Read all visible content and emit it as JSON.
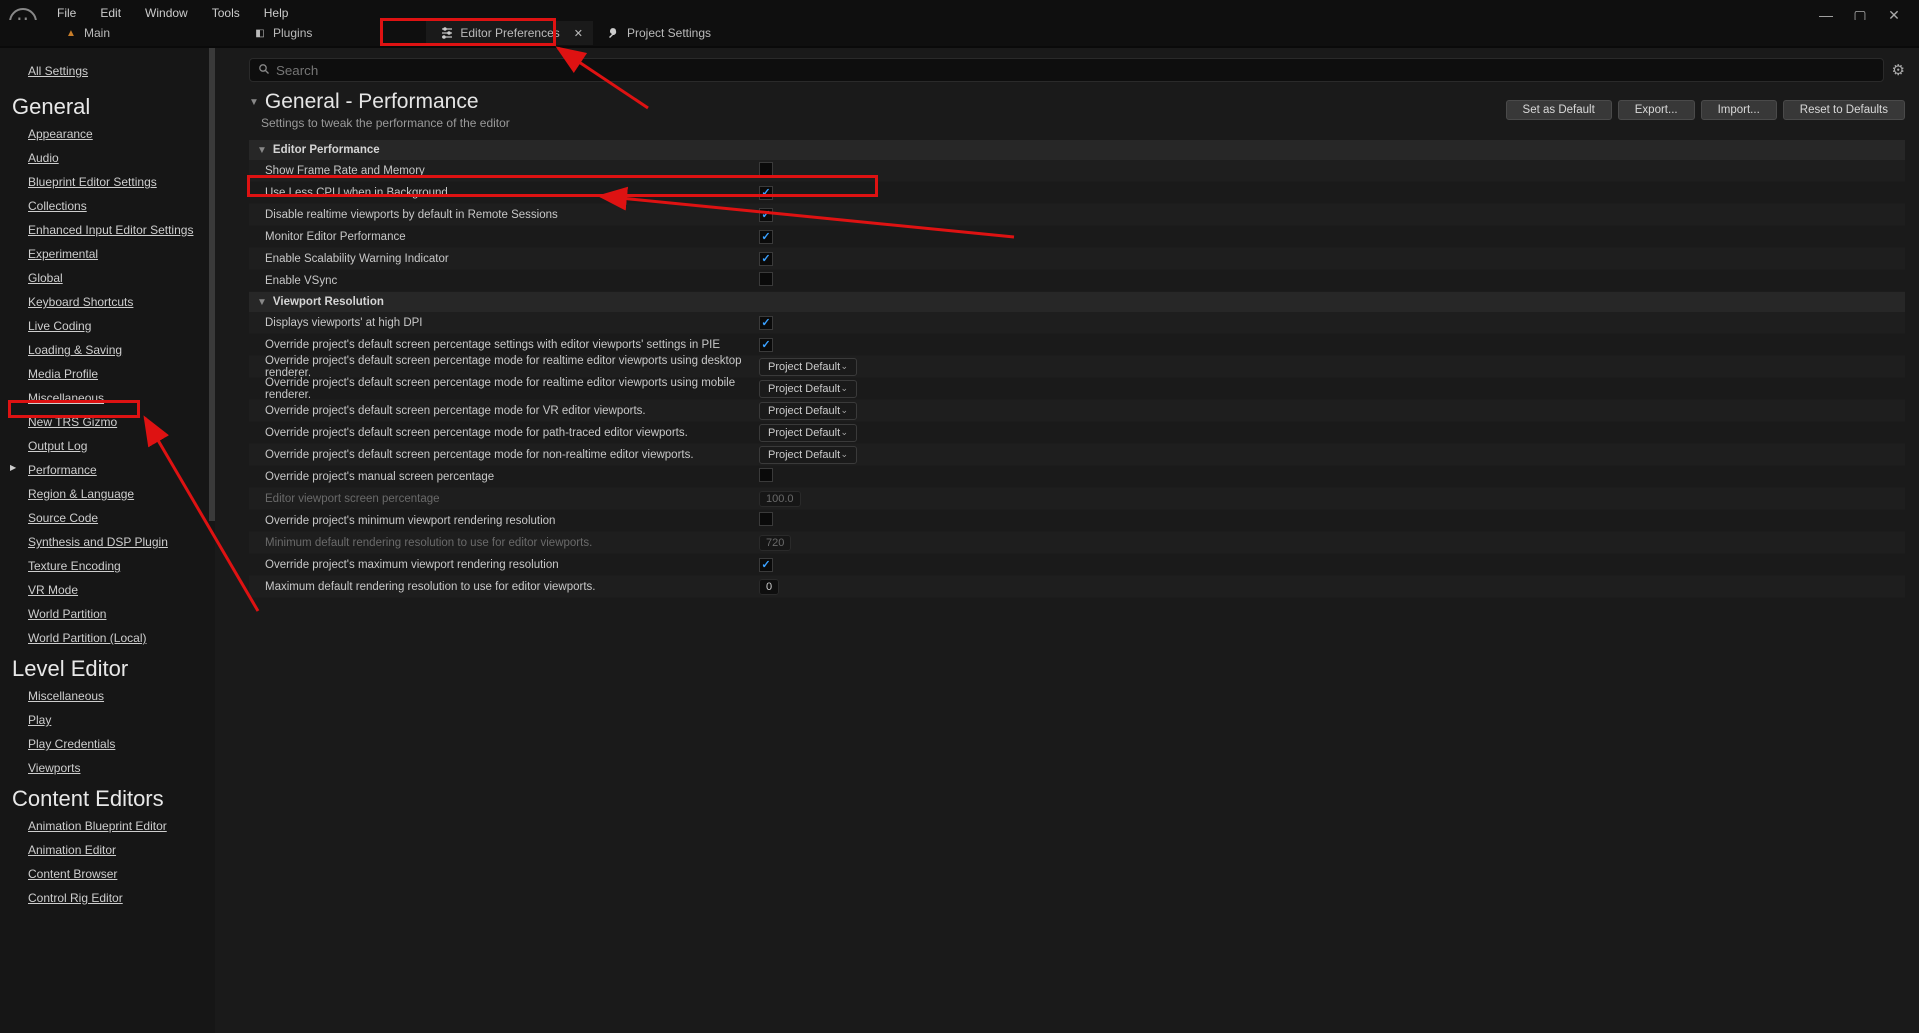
{
  "menu": {
    "file": "File",
    "edit": "Edit",
    "window": "Window",
    "tools": "Tools",
    "help": "Help"
  },
  "tabs": {
    "main": "Main",
    "plugins": "Plugins",
    "prefs": "Editor Preferences",
    "proj": "Project Settings"
  },
  "search": {
    "placeholder": "Search"
  },
  "sidebar": {
    "all": "All Settings",
    "general_h": "General",
    "general": [
      "Appearance",
      "Audio",
      "Blueprint Editor Settings",
      "Collections",
      "Enhanced Input Editor Settings",
      "Experimental",
      "Global",
      "Keyboard Shortcuts",
      "Live Coding",
      "Loading & Saving",
      "Media Profile",
      "Miscellaneous",
      "New TRS Gizmo",
      "Output Log",
      "Performance",
      "Region & Language",
      "Source Code",
      "Synthesis and DSP Plugin",
      "Texture Encoding",
      "VR Mode",
      "World Partition",
      "World Partition (Local)"
    ],
    "level_h": "Level Editor",
    "level": [
      "Miscellaneous",
      "Play",
      "Play Credentials",
      "Viewports"
    ],
    "content_h": "Content Editors",
    "content": [
      "Animation Blueprint Editor",
      "Animation Editor",
      "Content Browser",
      "Control Rig Editor"
    ]
  },
  "page": {
    "title": "General - Performance",
    "subtitle": "Settings to tweak the performance of the editor",
    "btn_default": "Set as Default",
    "btn_export": "Export...",
    "btn_import": "Import...",
    "btn_reset": "Reset to Defaults"
  },
  "sections": {
    "editor_perf": "Editor Performance",
    "viewport_res": "Viewport Resolution"
  },
  "rows": {
    "show_frame": "Show Frame Rate and Memory",
    "use_less_cpu": "Use Less CPU when in Background",
    "disable_realtime": "Disable realtime viewports by default in Remote Sessions",
    "monitor_perf": "Monitor Editor Performance",
    "scalability_warn": "Enable Scalability Warning Indicator",
    "enable_vsync": "Enable VSync",
    "high_dpi": "Displays viewports' at high DPI",
    "override_pie": "Override project's default screen percentage settings with editor viewports' settings in PIE",
    "override_desktop": "Override project's default screen percentage mode for realtime editor viewports using desktop renderer.",
    "override_mobile": "Override project's default screen percentage mode for realtime editor viewports using mobile renderer.",
    "override_vr": "Override project's default screen percentage mode for VR editor viewports.",
    "override_path": "Override project's default screen percentage mode for path-traced editor viewports.",
    "override_nonrt": "Override project's default screen percentage mode for non-realtime editor viewports.",
    "override_manual": "Override project's manual screen percentage",
    "editor_sp": "Editor viewport screen percentage",
    "override_min": "Override project's minimum viewport rendering resolution",
    "min_res": "Minimum default rendering resolution to use for editor viewports.",
    "override_max": "Override project's maximum viewport rendering resolution",
    "max_res": "Maximum default rendering resolution to use for editor viewports."
  },
  "values": {
    "project_default": "Project Default",
    "editor_sp_val": "100.0",
    "min_res_val": "720",
    "max_res_val": "0"
  },
  "checks": {
    "show_frame": false,
    "use_less_cpu": true,
    "disable_realtime": true,
    "monitor_perf": true,
    "scalability_warn": true,
    "enable_vsync": false,
    "high_dpi": true,
    "override_pie": true,
    "override_manual": false,
    "override_min": false,
    "override_max": true
  }
}
